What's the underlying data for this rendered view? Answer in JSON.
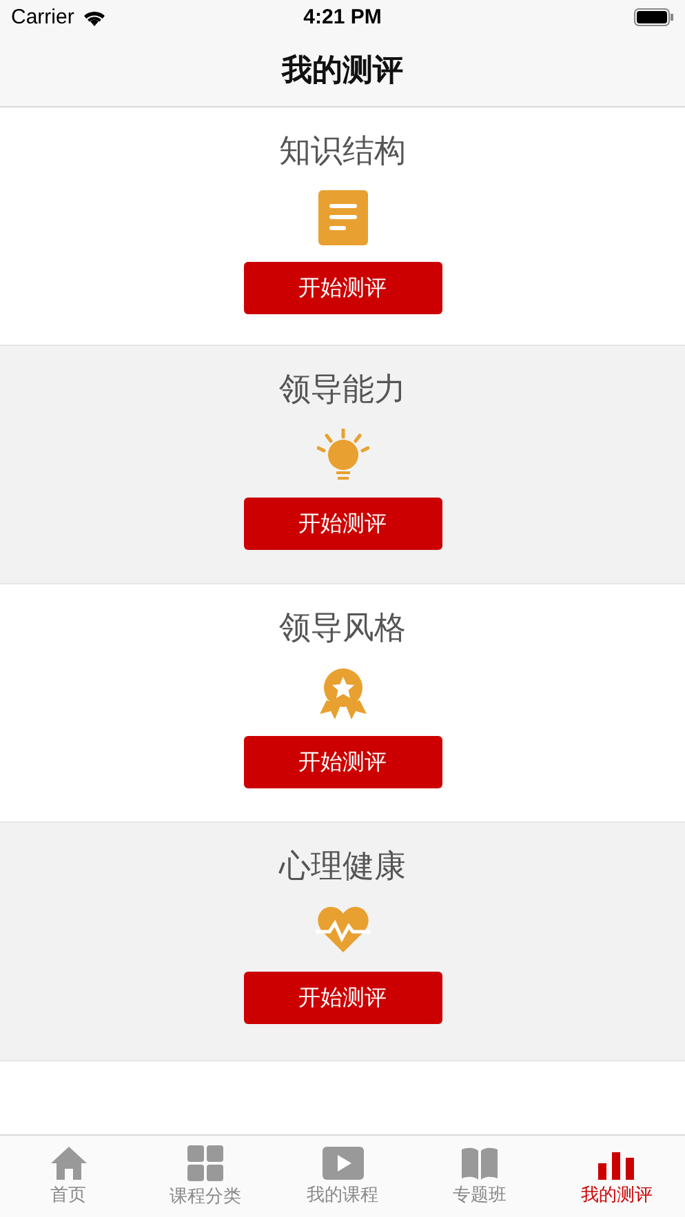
{
  "status_bar": {
    "carrier": "Carrier",
    "time": "4:21 PM"
  },
  "nav_bar": {
    "title": "我的测评"
  },
  "assessments": [
    {
      "title": "知识结构",
      "kind": "document",
      "button": "开始测评",
      "shaded": false
    },
    {
      "title": "领导能力",
      "kind": "bulb",
      "button": "开始测评",
      "shaded": true
    },
    {
      "title": "领导风格",
      "kind": "medal",
      "button": "开始测评",
      "shaded": false
    },
    {
      "title": "心理健康",
      "kind": "heart",
      "button": "开始测评",
      "shaded": true
    }
  ],
  "tab_bar": [
    {
      "label": "首页",
      "kind": "home",
      "selected": false
    },
    {
      "label": "课程分类",
      "kind": "grid",
      "selected": false
    },
    {
      "label": "我的课程",
      "kind": "video",
      "selected": false
    },
    {
      "label": "专题班",
      "kind": "book",
      "selected": false
    },
    {
      "label": "我的测评",
      "kind": "chart",
      "selected": true
    }
  ]
}
